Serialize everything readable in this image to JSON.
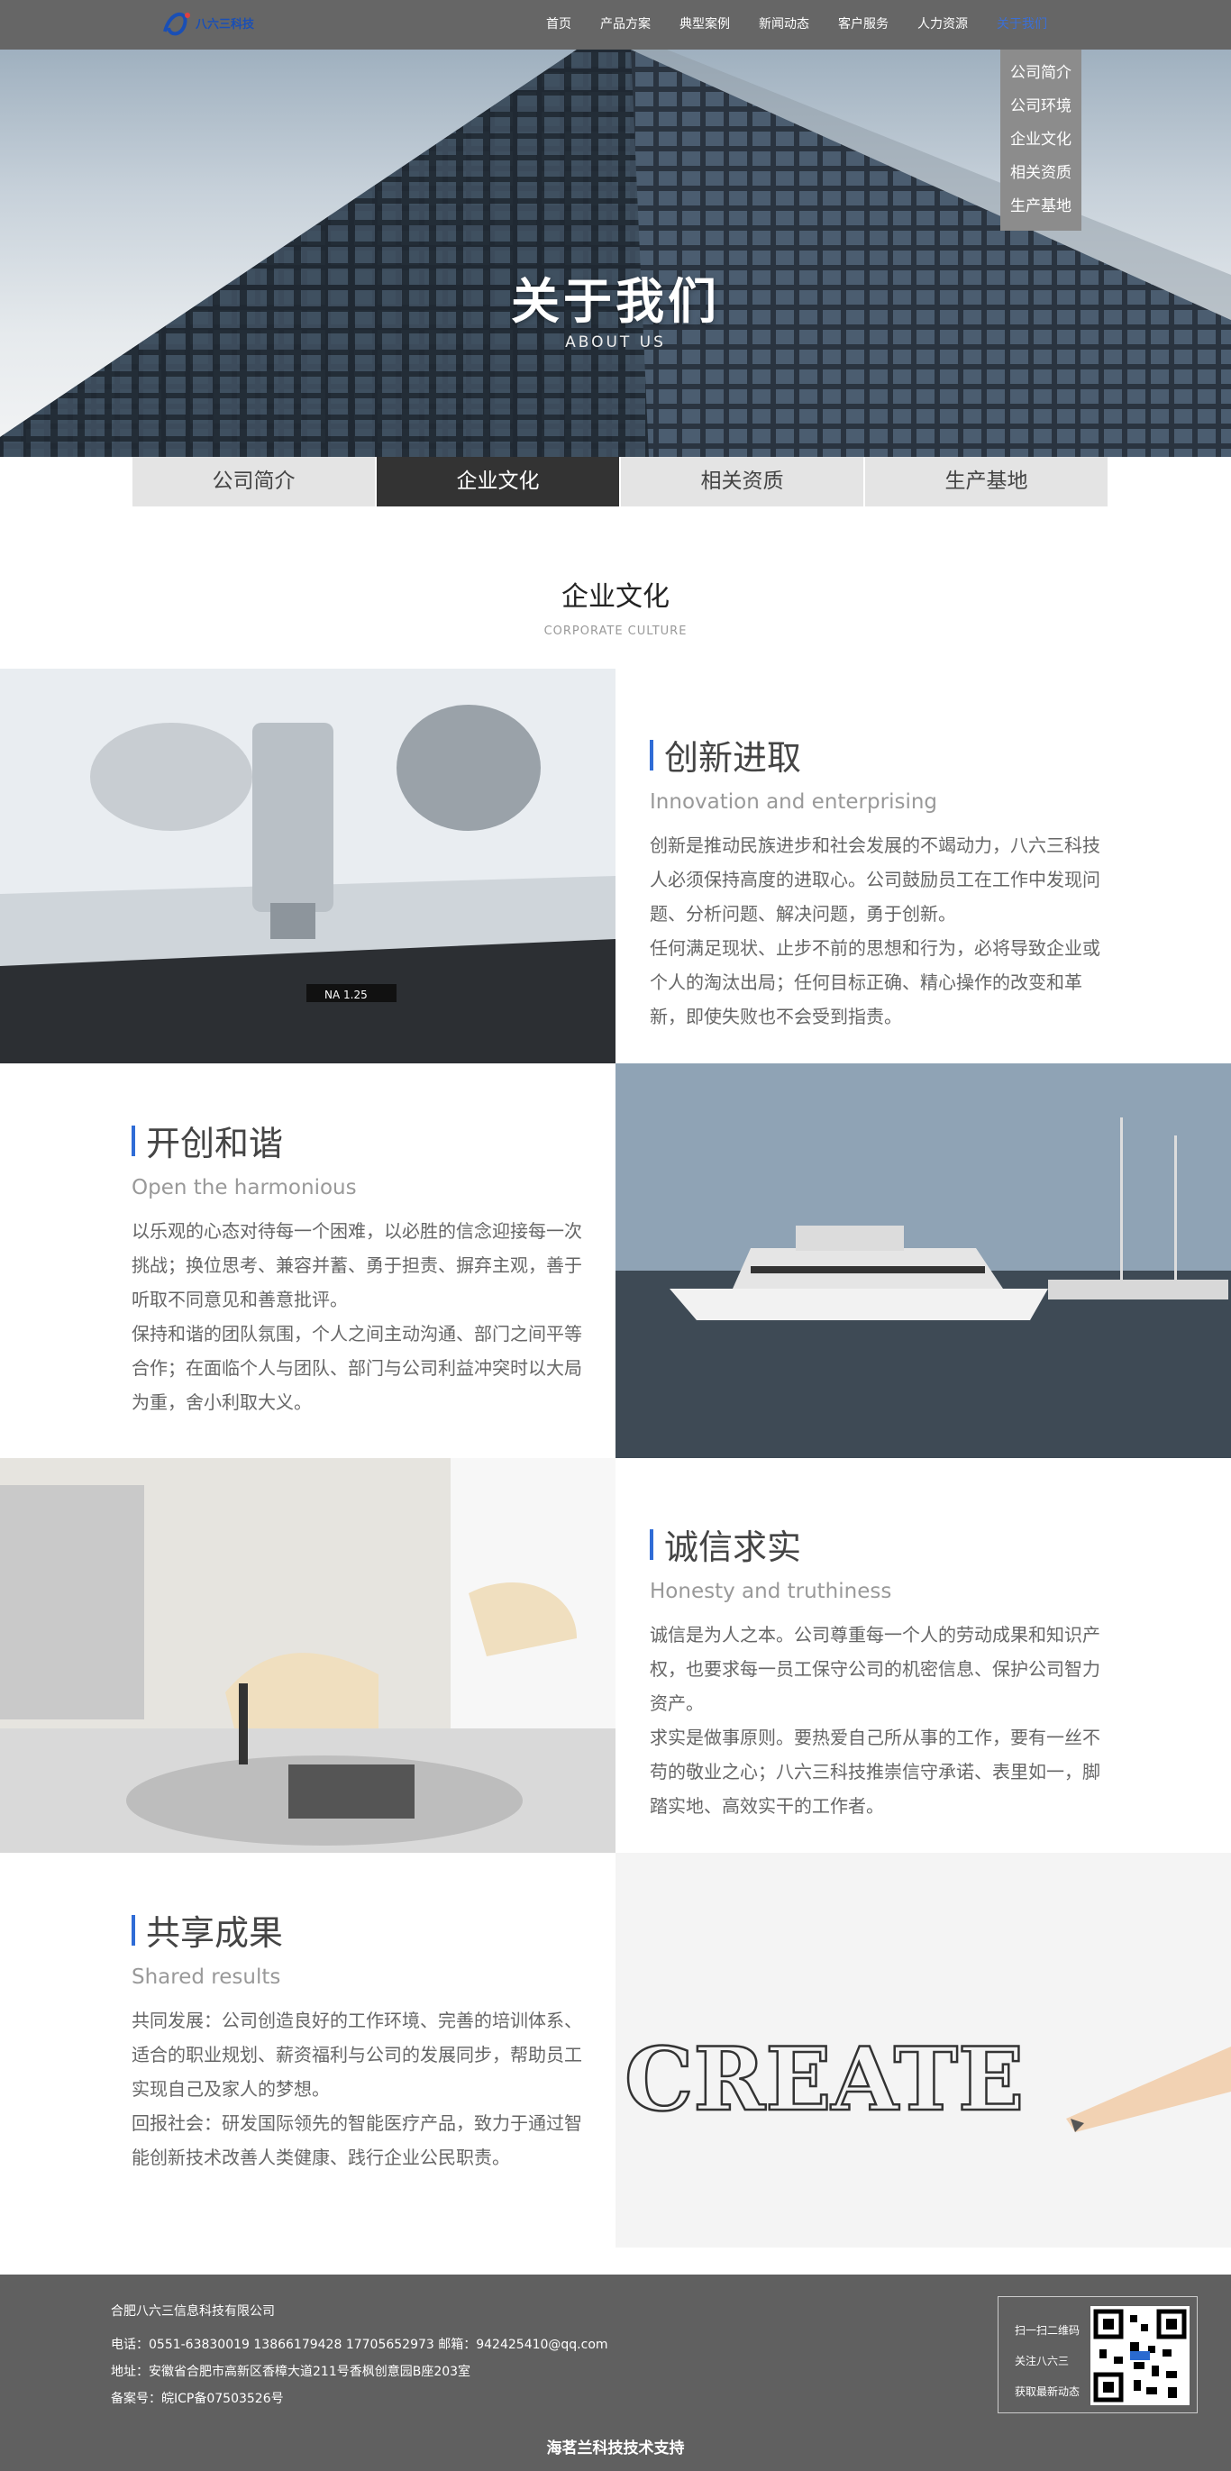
{
  "nav": {
    "logo_text": "八六三科技",
    "items": [
      "首页",
      "产品方案",
      "典型案例",
      "新闻动态",
      "客户服务",
      "人力资源",
      "关于我们"
    ],
    "dropdown": [
      "公司简介",
      "公司环境",
      "企业文化",
      "相关资质",
      "生产基地"
    ]
  },
  "hero": {
    "title": "关于我们",
    "subtitle": "ABOUT US"
  },
  "subtabs": [
    "公司简介",
    "企业文化",
    "相关资质",
    "生产基地"
  ],
  "section": {
    "title": "企业文化",
    "subtitle": "CORPORATE CULTURE"
  },
  "blocks": [
    {
      "title": "创新进取",
      "en": "Innovation and enterprising",
      "p1": "创新是推动民族进步和社会发展的不竭动力，八六三科技人必须保持高度的进取心。公司鼓励员工在工作中发现问题、分析问题、解决问题，勇于创新。",
      "p2": "任何满足现状、止步不前的思想和行为，必将导致企业或个人的淘汰出局；任何目标正确、精心操作的改变和革新，即使失败也不会受到指责。"
    },
    {
      "title": "开创和谐",
      "en": "Open the harmonious",
      "p1": "以乐观的心态对待每一个困难，以必胜的信念迎接每一次挑战；换位思考、兼容并蓄、勇于担责、摒弃主观，善于听取不同意见和善意批评。",
      "p2": "保持和谐的团队氛围，个人之间主动沟通、部门之间平等合作；在面临个人与团队、部门与公司利益冲突时以大局为重，舍小利取大义。"
    },
    {
      "title": "诚信求实",
      "en": "Honesty and truthiness",
      "p1": "诚信是为人之本。公司尊重每一个人的劳动成果和知识产权，也要求每一员工保守公司的机密信息、保护公司智力资产。",
      "p2": "求实是做事原则。要热爱自己所从事的工作，要有一丝不苟的敬业之心；八六三科技推崇信守承诺、表里如一，脚踏实地、高效实干的工作者。"
    },
    {
      "title": "共享成果",
      "en": "Shared results",
      "p1": "共同发展：公司创造良好的工作环境、完善的培训体系、适合的职业规划、薪资福利与公司的发展同步，帮助员工实现自己及家人的梦想。",
      "p2": "回报社会：研发国际领先的智能医疗产品，致力于通过智能创新技术改善人类健康、践行企业公民职责。"
    }
  ],
  "create_word": "CREATE",
  "na_label": "NA 1.25",
  "footer": {
    "company": "合肥八六三信息科技有限公司",
    "phone": "电话：0551-63830019    13866179428   17705652973   邮箱：942425410@qq.com",
    "address": "地址：安徽省合肥市高新区香樟大道211号香枫创意园B座203室",
    "icp": "备案号：皖ICP备07503526号",
    "qr_lines": [
      "扫一扫二维码",
      "关注八六三",
      "获取最新动态"
    ],
    "support": "海茗兰科技技术支持"
  },
  "colors": {
    "nav_bg": "#666666",
    "accent": "#2f6cd6",
    "footer_bg": "#606060",
    "active_tab": "#333333"
  }
}
